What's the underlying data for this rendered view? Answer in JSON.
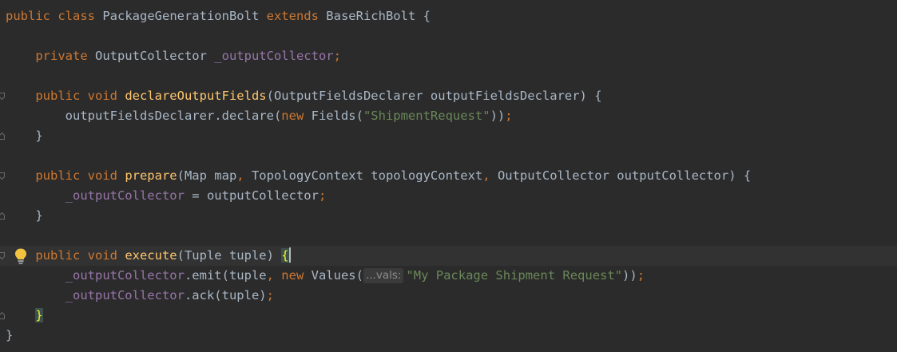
{
  "code_lines": [
    {
      "tokens": [
        {
          "t": "public class ",
          "c": "kw"
        },
        {
          "t": "PackageGenerationBolt ",
          "c": "plain"
        },
        {
          "t": "extends ",
          "c": "kw"
        },
        {
          "t": "BaseRichBolt {",
          "c": "plain"
        }
      ]
    },
    {
      "tokens": []
    },
    {
      "tokens": [
        {
          "t": "    private ",
          "c": "kw"
        },
        {
          "t": "OutputCollector ",
          "c": "plain"
        },
        {
          "t": "_outputCollector",
          "c": "fld"
        },
        {
          "t": ";",
          "c": "punct"
        }
      ]
    },
    {
      "tokens": []
    },
    {
      "fold": "start",
      "tokens": [
        {
          "t": "    public void ",
          "c": "kw"
        },
        {
          "t": "declareOutputFields",
          "c": "fn"
        },
        {
          "t": "(OutputFieldsDeclarer outputFieldsDeclarer) {",
          "c": "plain"
        }
      ]
    },
    {
      "tokens": [
        {
          "t": "        outputFieldsDeclarer.declare(",
          "c": "plain"
        },
        {
          "t": "new ",
          "c": "kw"
        },
        {
          "t": "Fields(",
          "c": "plain"
        },
        {
          "t": "\"ShipmentRequest\"",
          "c": "str"
        },
        {
          "t": "))",
          "c": "plain"
        },
        {
          "t": ";",
          "c": "punct"
        }
      ]
    },
    {
      "fold": "end",
      "tokens": [
        {
          "t": "    }",
          "c": "plain"
        }
      ]
    },
    {
      "tokens": []
    },
    {
      "fold": "start",
      "tokens": [
        {
          "t": "    public void ",
          "c": "kw"
        },
        {
          "t": "prepare",
          "c": "fn"
        },
        {
          "t": "(Map map",
          "c": "plain"
        },
        {
          "t": ", ",
          "c": "punct"
        },
        {
          "t": "TopologyContext topologyContext",
          "c": "plain"
        },
        {
          "t": ", ",
          "c": "punct"
        },
        {
          "t": "OutputCollector outputCollector) {",
          "c": "plain"
        }
      ]
    },
    {
      "tokens": [
        {
          "t": "        ",
          "c": "plain"
        },
        {
          "t": "_outputCollector",
          "c": "fld"
        },
        {
          "t": " = outputCollector",
          "c": "plain"
        },
        {
          "t": ";",
          "c": "punct"
        }
      ]
    },
    {
      "fold": "end",
      "tokens": [
        {
          "t": "    }",
          "c": "plain"
        }
      ]
    },
    {
      "tokens": []
    },
    {
      "fold": "start",
      "current": true,
      "bulb": true,
      "tokens": [
        {
          "t": "    public void ",
          "c": "kw"
        },
        {
          "t": "execute",
          "c": "fn"
        },
        {
          "t": "(Tuple tuple) ",
          "c": "plain"
        },
        {
          "t": "{",
          "c": "brace-hl"
        },
        {
          "t": "",
          "c": "caret"
        }
      ]
    },
    {
      "tokens": [
        {
          "t": "        ",
          "c": "plain"
        },
        {
          "t": "_outputCollector",
          "c": "fld"
        },
        {
          "t": ".emit(tuple",
          "c": "plain"
        },
        {
          "t": ", ",
          "c": "punct"
        },
        {
          "t": "new ",
          "c": "kw"
        },
        {
          "t": "Values(",
          "c": "plain"
        },
        {
          "t": "...vals:",
          "c": "hint"
        },
        {
          "t": "\"My Package Shipment Request\"",
          "c": "str"
        },
        {
          "t": "))",
          "c": "plain"
        },
        {
          "t": ";",
          "c": "punct"
        }
      ]
    },
    {
      "tokens": [
        {
          "t": "        ",
          "c": "plain"
        },
        {
          "t": "_outputCollector",
          "c": "fld"
        },
        {
          "t": ".ack(tuple)",
          "c": "plain"
        },
        {
          "t": ";",
          "c": "punct"
        }
      ]
    },
    {
      "fold": "end",
      "tokens": [
        {
          "t": "    ",
          "c": "plain"
        },
        {
          "t": "}",
          "c": "brace-hl"
        }
      ]
    },
    {
      "tokens": [
        {
          "t": "}",
          "c": "plain"
        }
      ]
    }
  ],
  "icons": {
    "bulb": "lightbulb-icon",
    "fold_start": "fold-start-icon",
    "fold_end": "fold-end-icon"
  },
  "colors": {
    "background": "#2b2b2b",
    "current_line": "#323232",
    "keyword": "#cc7832",
    "field": "#9876aa",
    "method": "#ffc66d",
    "string": "#6a8759",
    "text": "#a9b7c6"
  }
}
